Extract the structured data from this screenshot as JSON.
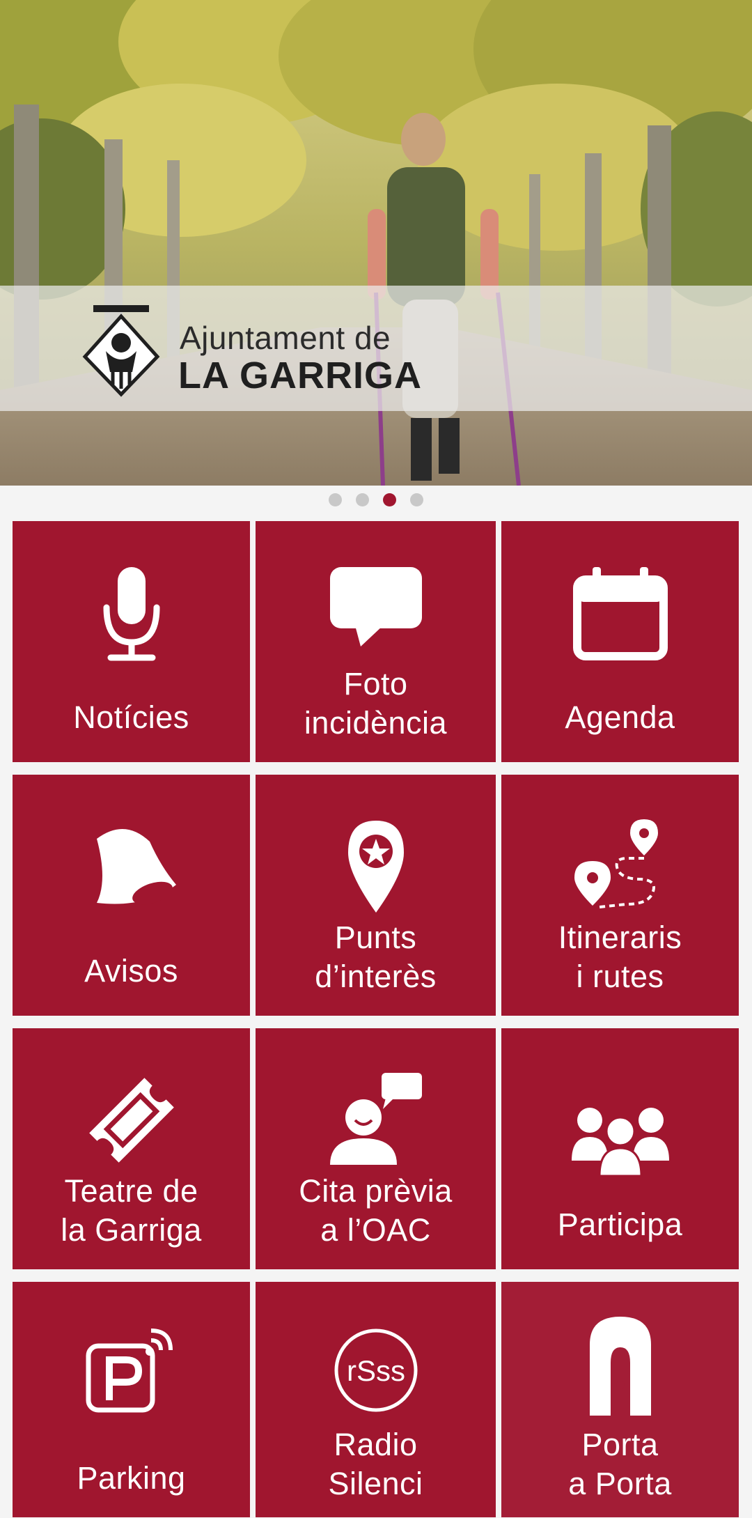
{
  "header": {
    "logo_line1": "Ajuntament de",
    "logo_line2": "LA GARRIGA"
  },
  "carousel": {
    "slide_count": 4,
    "active_index": 2
  },
  "theme": {
    "accent": "#a0162f",
    "dot_inactive": "#c8c8c8",
    "background": "#f4f4f4"
  },
  "tiles": [
    {
      "label": "Notícies",
      "icon": "microphone-icon"
    },
    {
      "label": "Foto\nincidència",
      "icon": "speech-bubble-icon"
    },
    {
      "label": "Agenda",
      "icon": "calendar-icon"
    },
    {
      "label": "Avisos",
      "icon": "bell-icon"
    },
    {
      "label": "Punts\nd’interès",
      "icon": "map-pin-star-icon"
    },
    {
      "label": "Itineraris\ni rutes",
      "icon": "route-icon"
    },
    {
      "label": "Teatre de\nla Garriga",
      "icon": "ticket-icon"
    },
    {
      "label": "Cita prèvia\na l’OAC",
      "icon": "person-chat-icon"
    },
    {
      "label": "Participa",
      "icon": "group-icon"
    },
    {
      "label": "Parking",
      "icon": "parking-icon"
    },
    {
      "label": "Radio\nSilenci",
      "icon": "radio-icon"
    },
    {
      "label": "Porta\na Porta",
      "icon": "door-bin-icon"
    }
  ]
}
